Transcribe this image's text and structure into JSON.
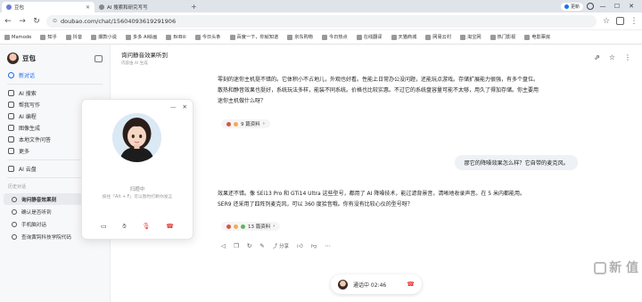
{
  "browser": {
    "tabs": [
      {
        "label": "豆包",
        "active": true
      },
      {
        "label": "AI 搜索和研究写写",
        "active": false
      }
    ],
    "update_label": "更新",
    "url": "doubao.com/chat/15604093619291906",
    "bookmarks": [
      "Mamode",
      "知乎",
      "抖音",
      "爆款小说",
      "多多 AI绘画",
      "BilBili",
      "今日头条",
      "百度一下，你就知道",
      "京东购物",
      "今日热点",
      "在线翻译",
      "天猫商城",
      "网易云村",
      "淘宝网",
      "热门影视",
      "电影票房"
    ]
  },
  "sidebar": {
    "title": "豆包",
    "new_chat": "新对话",
    "items": [
      "AI 搜索",
      "帮我写作",
      "AI 编程",
      "图像生成",
      "本地文件问答",
      "更多"
    ],
    "cloud": "AI 云盘",
    "history_section": "历史对话",
    "history": [
      {
        "label": "询问静音效果刻",
        "active": true,
        "badge": false
      },
      {
        "label": "确认是否听到",
        "active": false,
        "badge": false
      },
      {
        "label": "手机脑对话",
        "active": false,
        "badge": true
      },
      {
        "label": "查询黄钩科技学院代码",
        "active": false,
        "badge": false
      }
    ]
  },
  "chat": {
    "title": "询问静音效果听到",
    "subtitle": "内容由 AI 生成",
    "bot_msg_1": "零刻的迷你主机挺不错的。它体积小不占地儿，外观也好看。性能上日常办公没问题，还能玩点游戏。存储扩展能力很强，有多个盘位。散热和静音效果也挺好，系统玩法多样，能装不同系统。价格也比较实惠。不过它的系统盘容量可能不太够，用久了得加存储。你主要用迷你主机做什么呀？",
    "refs_1": "9 篇资料",
    "user_msg": "那它的降噪效果怎么样？它自带的麦克风。",
    "bot_msg_2": "效果还不错。像 SEi13 Pro 和 GTi14 Ultra 这些型号，都用了 AI 降噪技术，能过滤背景音，清晰地收录声音。在 5 米内都能用。SER9 还采用了四阵列麦克风，可以 360 度拾音哦。你有没有比较心仪的型号呀？",
    "refs_2": "13 篇资料",
    "share": "分享",
    "call_status": "通话中 02:46"
  },
  "call_window": {
    "status": "扫题中",
    "hint": "按住「Alt + F」可以暂时打断你发言"
  },
  "watermark": "新 值"
}
